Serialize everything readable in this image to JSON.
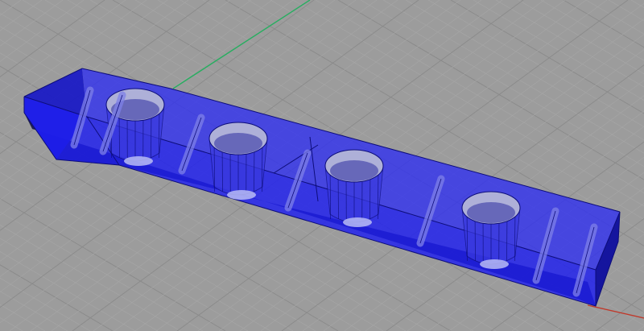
{
  "viewport": {
    "view": "perspective",
    "background_color": "#9c9c9c",
    "grid_minor_color": "#a7a7a7",
    "grid_major_color": "#8a8a8a",
    "axis_x_color": "#c0392b",
    "axis_y_color": "#27ae60"
  },
  "model": {
    "shape": "rectangular bar with four cylindrical pockets",
    "display_mode": "x-ray",
    "fill_color": "#1f1ff0",
    "edge_color": "#0d0d7a",
    "pocket_count": 4,
    "pin_count": 7
  }
}
